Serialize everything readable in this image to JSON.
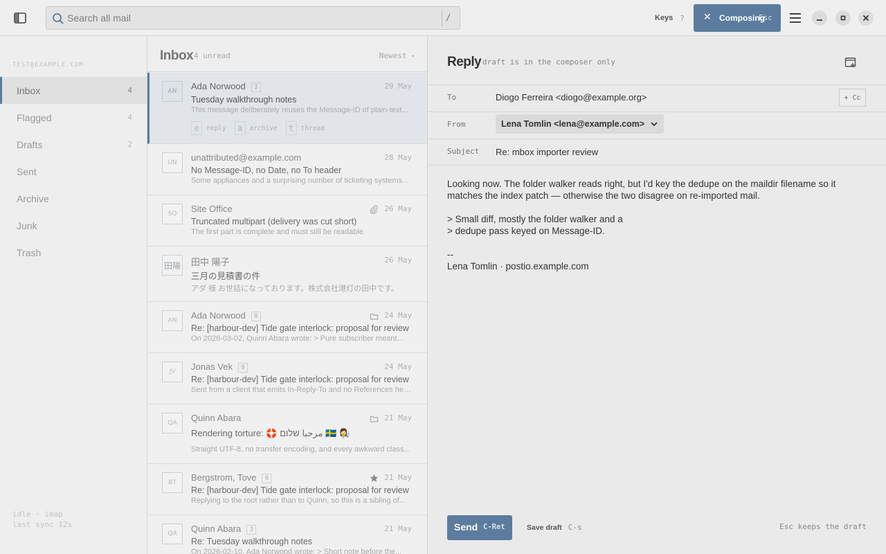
{
  "header": {
    "search_placeholder": "Search all mail",
    "search_shortcut": "/",
    "keys_label": "Keys",
    "keys_shortcut": "?",
    "composing_label": "Composing",
    "composing_shortcut": "Esc"
  },
  "sidebar": {
    "account": "test@example.com",
    "folders": [
      {
        "name": "Inbox",
        "count": "4"
      },
      {
        "name": "Flagged",
        "count": "4"
      },
      {
        "name": "Drafts",
        "count": "2"
      },
      {
        "name": "Sent",
        "count": ""
      },
      {
        "name": "Archive",
        "count": ""
      },
      {
        "name": "Junk",
        "count": ""
      },
      {
        "name": "Trash",
        "count": ""
      }
    ],
    "status_line1": "idle · imap",
    "status_line2": "last sync 12s"
  },
  "list": {
    "title": "Inbox",
    "unread": "4 unread",
    "sort": "Newest",
    "messages": [
      {
        "initials": "AN",
        "sender": "Ada Norwood",
        "count": "3",
        "date": "29 May",
        "subject": "Tuesday walkthrough notes",
        "preview": "This message deliberately reuses the Message-ID of plain-text..."
      },
      {
        "initials": "UN",
        "sender": "unattributed@example.com",
        "count": "",
        "date": "28 May",
        "subject": "No Message-ID, no Date, no To header",
        "preview": "Some appliances and a surprising number of ticketing systems..."
      },
      {
        "initials": "SO",
        "sender": "Site Office",
        "count": "",
        "date": "26 May",
        "subject": "Truncated multipart (delivery was cut short)",
        "preview": "The first part is complete and must still be readable."
      },
      {
        "initials": "田陽",
        "sender": "田中 陽子",
        "count": "",
        "date": "26 May",
        "subject": "三月の見積書の件",
        "preview": "アダ 様 お世話になっております。株式会社港灯の田中です。"
      },
      {
        "initials": "AN",
        "sender": "Ada Norwood",
        "count": "8",
        "date": "24 May",
        "subject": "Re: [harbour-dev] Tide gate interlock: proposal for review",
        "preview": "On 2026-03-02, Quinn Abara wrote: > Pure subscriber meant..."
      },
      {
        "initials": "JV",
        "sender": "Jonas Vek",
        "count": "8",
        "date": "24 May",
        "subject": "Re: [harbour-dev] Tide gate interlock: proposal for review",
        "preview": "Sent from a client that emits In-Reply-To and no References header."
      },
      {
        "initials": "QA",
        "sender": "Quinn Abara",
        "count": "",
        "date": "21 May",
        "subject": "Rendering torture: 🛟 مرحبا שלום 🇸🇪 👩‍🔬",
        "preview": "Straight UTF-8, no transfer encoding, and every awkward class..."
      },
      {
        "initials": "BT",
        "sender": "Bergstrom, Tove",
        "count": "8",
        "date": "21 May",
        "subject": "Re: [harbour-dev] Tide gate interlock: proposal for review",
        "preview": "Replying to the root rather than to Quinn, so this is a sibling of..."
      },
      {
        "initials": "QA",
        "sender": "Quinn Abara",
        "count": "3",
        "date": "21 May",
        "subject": "Re: Tuesday walkthrough notes",
        "preview": "On 2026-02-10, Ada Norwood wrote: > Short note before the..."
      }
    ],
    "quick_actions": [
      {
        "key": "e",
        "label": "reply"
      },
      {
        "key": "a",
        "label": "archive"
      },
      {
        "key": "t",
        "label": "thread"
      }
    ]
  },
  "composer": {
    "title": "Reply",
    "note": "draft is in the composer only",
    "to_label": "To",
    "to_value": "Diogo Ferreira <diogo@example.org>",
    "cc_label": "+ Cc",
    "from_label": "From",
    "from_value": "Lena Tomlin <lena@example.com>",
    "subject_label": "Subject",
    "subject_value": "Re: mbox importer review",
    "body": "Looking now. The folder walker reads right, but I'd key the dedupe on the maildir filename so it\nmatches the index patch — otherwise the two disagree on re-imported mail.\n\n> Small diff, mostly the folder walker and a\n> dedupe pass keyed on Message-ID.\n\n--\nLena Tomlin · postio.example.com",
    "send_label": "Send",
    "send_shortcut": "C-Ret",
    "save_label": "Save draft",
    "save_shortcut": "C-s",
    "esc_note": "Esc keeps the draft"
  },
  "colors": {
    "accent": "#5b7c9e",
    "selected_row": "#e1e5ea"
  }
}
